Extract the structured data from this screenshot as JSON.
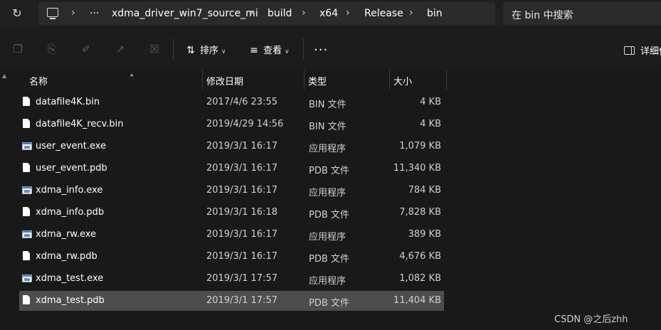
{
  "address": {
    "refresh_icon": "refresh-icon",
    "location_icon": "computer-icon",
    "more_crumbs": "···",
    "crumbs": [
      "xdma_driver_win7_source_mi",
      "build",
      "x64",
      "Release",
      "bin"
    ],
    "separator": "›",
    "search_placeholder": "在 bin 中搜索"
  },
  "toolbar": {
    "sort_label": "排序",
    "view_label": "查看",
    "more_label": "···",
    "details_label": "详细信"
  },
  "columns": [
    "名称",
    "修改日期",
    "类型",
    "大小"
  ],
  "files": [
    {
      "name": "datafile4K.bin",
      "date": "2017/4/6 23:55",
      "type": "BIN 文件",
      "size": "4 KB",
      "icon": "doc"
    },
    {
      "name": "datafile4K_recv.bin",
      "date": "2019/4/29 14:56",
      "type": "BIN 文件",
      "size": "4 KB",
      "icon": "doc"
    },
    {
      "name": "user_event.exe",
      "date": "2019/3/1 16:17",
      "type": "应用程序",
      "size": "1,079 KB",
      "icon": "exe"
    },
    {
      "name": "user_event.pdb",
      "date": "2019/3/1 16:17",
      "type": "PDB 文件",
      "size": "11,340 KB",
      "icon": "doc"
    },
    {
      "name": "xdma_info.exe",
      "date": "2019/3/1 16:17",
      "type": "应用程序",
      "size": "784 KB",
      "icon": "exe"
    },
    {
      "name": "xdma_info.pdb",
      "date": "2019/3/1 16:18",
      "type": "PDB 文件",
      "size": "7,828 KB",
      "icon": "doc"
    },
    {
      "name": "xdma_rw.exe",
      "date": "2019/3/1 16:17",
      "type": "应用程序",
      "size": "389 KB",
      "icon": "exe"
    },
    {
      "name": "xdma_rw.pdb",
      "date": "2019/3/1 16:17",
      "type": "PDB 文件",
      "size": "4,676 KB",
      "icon": "doc"
    },
    {
      "name": "xdma_test.exe",
      "date": "2019/3/1 17:57",
      "type": "应用程序",
      "size": "1,082 KB",
      "icon": "exe"
    },
    {
      "name": "xdma_test.pdb",
      "date": "2019/3/1 17:57",
      "type": "PDB 文件",
      "size": "11,404 KB",
      "icon": "doc",
      "selected": true
    }
  ],
  "watermark": "CSDN @之后zhh"
}
